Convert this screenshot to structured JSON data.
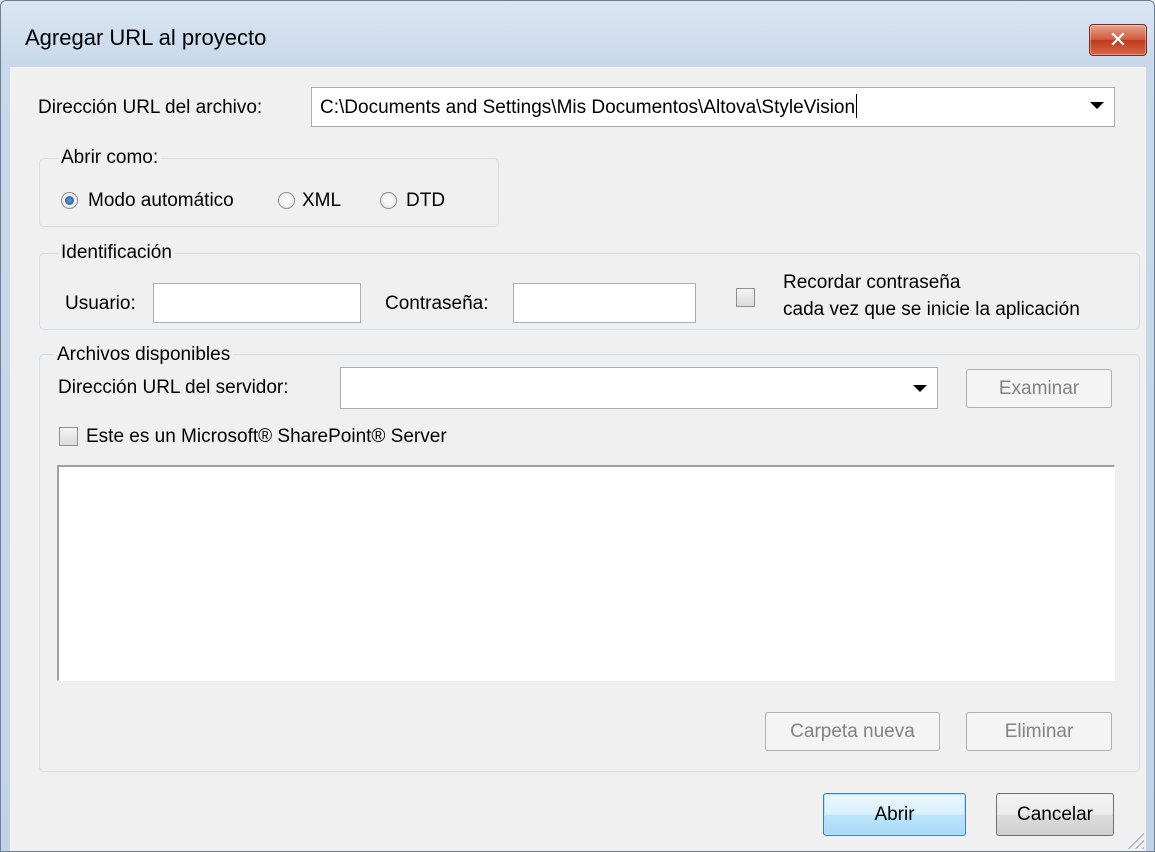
{
  "window": {
    "title": "Agregar URL al proyecto",
    "close_label": "✕"
  },
  "file_url": {
    "label": "Dirección URL del archivo:",
    "value": "C:\\Documents and Settings\\Mis Documentos\\Altova\\StyleVision"
  },
  "open_as": {
    "title": "Abrir como:",
    "options": [
      {
        "label": "Modo automático",
        "selected": true
      },
      {
        "label": "XML",
        "selected": false
      },
      {
        "label": "DTD",
        "selected": false
      }
    ]
  },
  "identification": {
    "title": "Identificación",
    "user_label": "Usuario:",
    "user_value": "",
    "password_label": "Contraseña:",
    "password_value": "",
    "remember_line1": "Recordar contraseña",
    "remember_line2": "cada vez que se inicie la aplicación",
    "remember_checked": false
  },
  "available_files": {
    "title": "Archivos disponibles",
    "server_url_label": "Dirección URL del servidor:",
    "server_url_value": "",
    "browse_label": "Examinar",
    "sharepoint_label": "Este es un Microsoft® SharePoint® Server",
    "sharepoint_checked": false,
    "new_folder_label": "Carpeta nueva",
    "delete_label": "Eliminar"
  },
  "footer": {
    "open_label": "Abrir",
    "cancel_label": "Cancelar"
  }
}
